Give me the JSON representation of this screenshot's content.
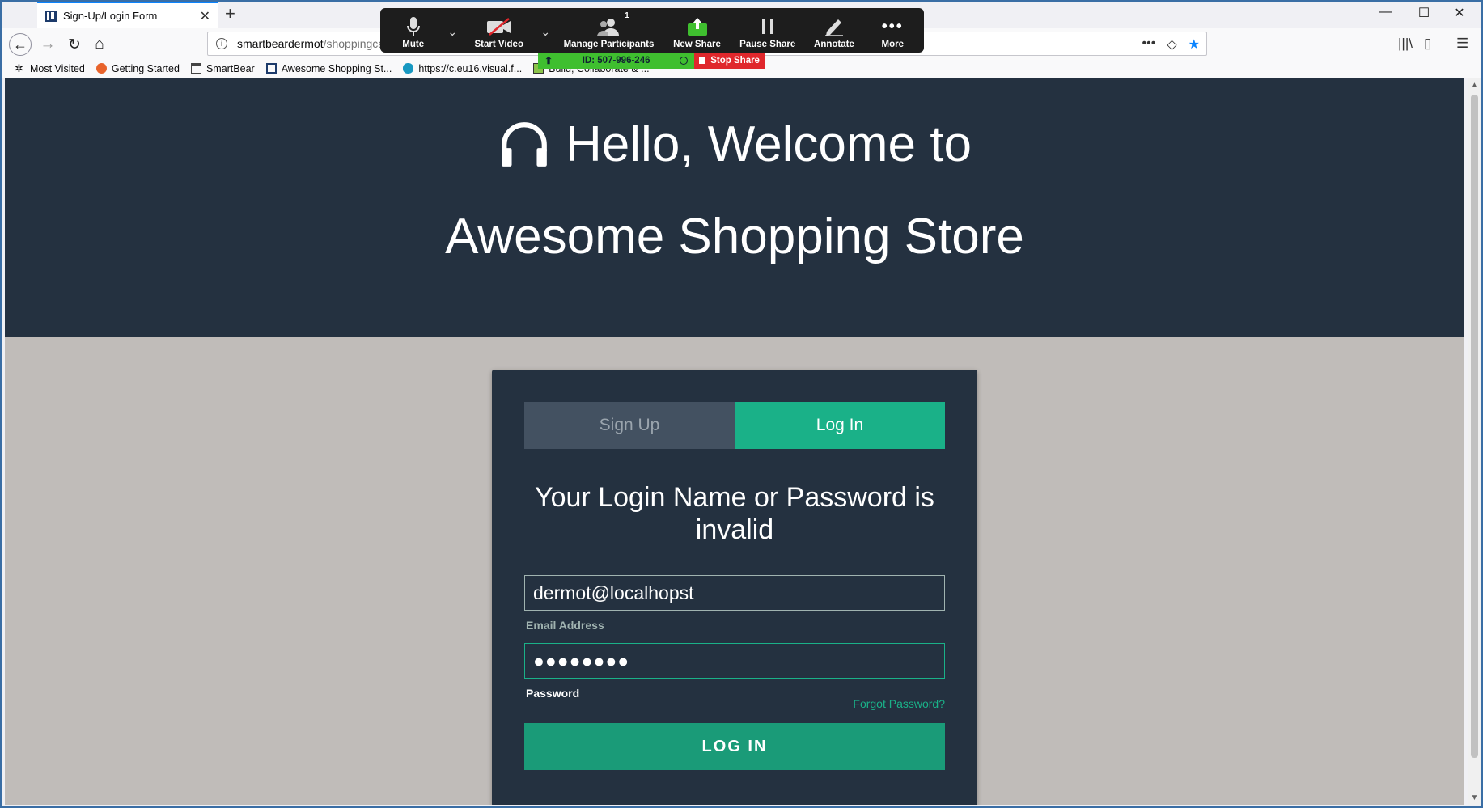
{
  "browser": {
    "tab_title": "Sign-Up/Login Form",
    "url_host": "smartbeardermot",
    "url_path": "/shoppingca"
  },
  "bookmarks": [
    {
      "label": "Most Visited",
      "icon": "gear-icon"
    },
    {
      "label": "Getting Started",
      "icon": "firefox-icon"
    },
    {
      "label": "SmartBear",
      "icon": "folder-icon"
    },
    {
      "label": "Awesome Shopping St...",
      "icon": "site-icon"
    },
    {
      "label": "https://c.eu16.visual.f...",
      "icon": "cloud-icon"
    },
    {
      "label": "Build, Collaborate & ...",
      "icon": "code-icon"
    }
  ],
  "zoom": {
    "mute": "Mute",
    "start_video": "Start Video",
    "manage_participants": "Manage Participants",
    "participant_count": "1",
    "new_share": "New Share",
    "pause_share": "Pause Share",
    "annotate": "Annotate",
    "more": "More",
    "meeting_id": "ID: 507-996-246",
    "stop_share": "Stop Share"
  },
  "hero": {
    "line1": "Hello, Welcome to",
    "line2": "Awesome Shopping Store"
  },
  "form": {
    "tab_signup": "Sign Up",
    "tab_login": "Log In",
    "error_message": "Your Login Name or Password is invalid",
    "email_value": "dermot@localhopst",
    "email_label": "Email Address",
    "password_value": "●●●●●●●●",
    "password_label": "Password",
    "forgot_link": "Forgot Password?",
    "login_button": "LOG IN"
  },
  "colors": {
    "accent": "#1ab188",
    "hero_bg": "#243140",
    "page_bg": "#c0bcb9",
    "zoom_green": "#3fbf2f",
    "zoom_red": "#e0272c"
  }
}
